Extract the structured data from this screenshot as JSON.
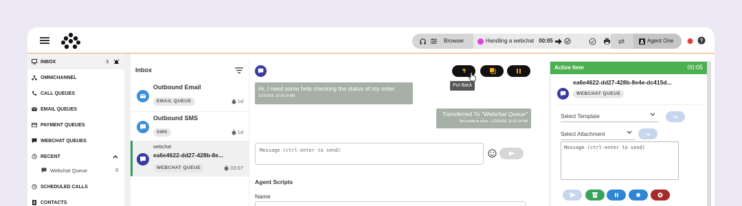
{
  "topbar": {
    "browser_label": "Browser",
    "status_label": "Handling a webchat",
    "timer": "00:05",
    "agent_name": "Agent One"
  },
  "nav": {
    "items": [
      {
        "label": "INBOX",
        "count": "3"
      },
      {
        "label": "OMNICHANNEL"
      },
      {
        "label": "CALL QUEUES"
      },
      {
        "label": "EMAIL QUEUES"
      },
      {
        "label": "PAYMENT QUEUES"
      },
      {
        "label": "WEBCHAT QUEUES"
      },
      {
        "label": "RECENT"
      },
      {
        "label": "SCHEDULED CALLS"
      },
      {
        "label": "CONTACTS"
      }
    ],
    "recent_sub": {
      "label": "Webchat Queue",
      "count": "0"
    }
  },
  "inbox": {
    "title": "Inbox",
    "rows": [
      {
        "title": "Outbound Email",
        "queue": "EMAIL QUEUE",
        "time": "1d"
      },
      {
        "title": "Outbound SMS",
        "queue": "SMS",
        "time": "1d"
      },
      {
        "subtitle": "webchat",
        "title": "ea6e4622-dd27-428b-8e...",
        "queue": "WEBCHAT QUEUE",
        "time": "03:07"
      }
    ]
  },
  "chat": {
    "tooltip": "Put Back",
    "incoming": {
      "text": "Hi, I need some help checking the status of my order",
      "meta": "1/23/2026, 10:25:14 AM"
    },
    "outgoing": {
      "text": "Transferred To \"Webchat Queue\"",
      "meta": "Not visible to client - 1/23/2026, 10:25:14 AM"
    },
    "message_placeholder": "Message (ctrl-enter to send)",
    "scripts_title": "Agent Scripts",
    "name_label": "Name"
  },
  "active_item": {
    "header": "Active Item",
    "timer": "00:05",
    "title": "ea6e4622-dd27-428b-8e4e-dc415d...",
    "queue": "WEBCHAT QUEUE",
    "template_placeholder": "Select Template",
    "attachment_placeholder": "Select Attachment",
    "message_placeholder": "Message (ctrl-enter to send)"
  },
  "colors": {
    "accent_green": "#4caf50",
    "avatar_blue": "#3d8fd9",
    "avatar_purple": "#3a3aa0",
    "status_magenta": "#e040e0",
    "btn_green": "#3aa35a",
    "btn_blue": "#2f86d6",
    "btn_red": "#a52a2a"
  }
}
